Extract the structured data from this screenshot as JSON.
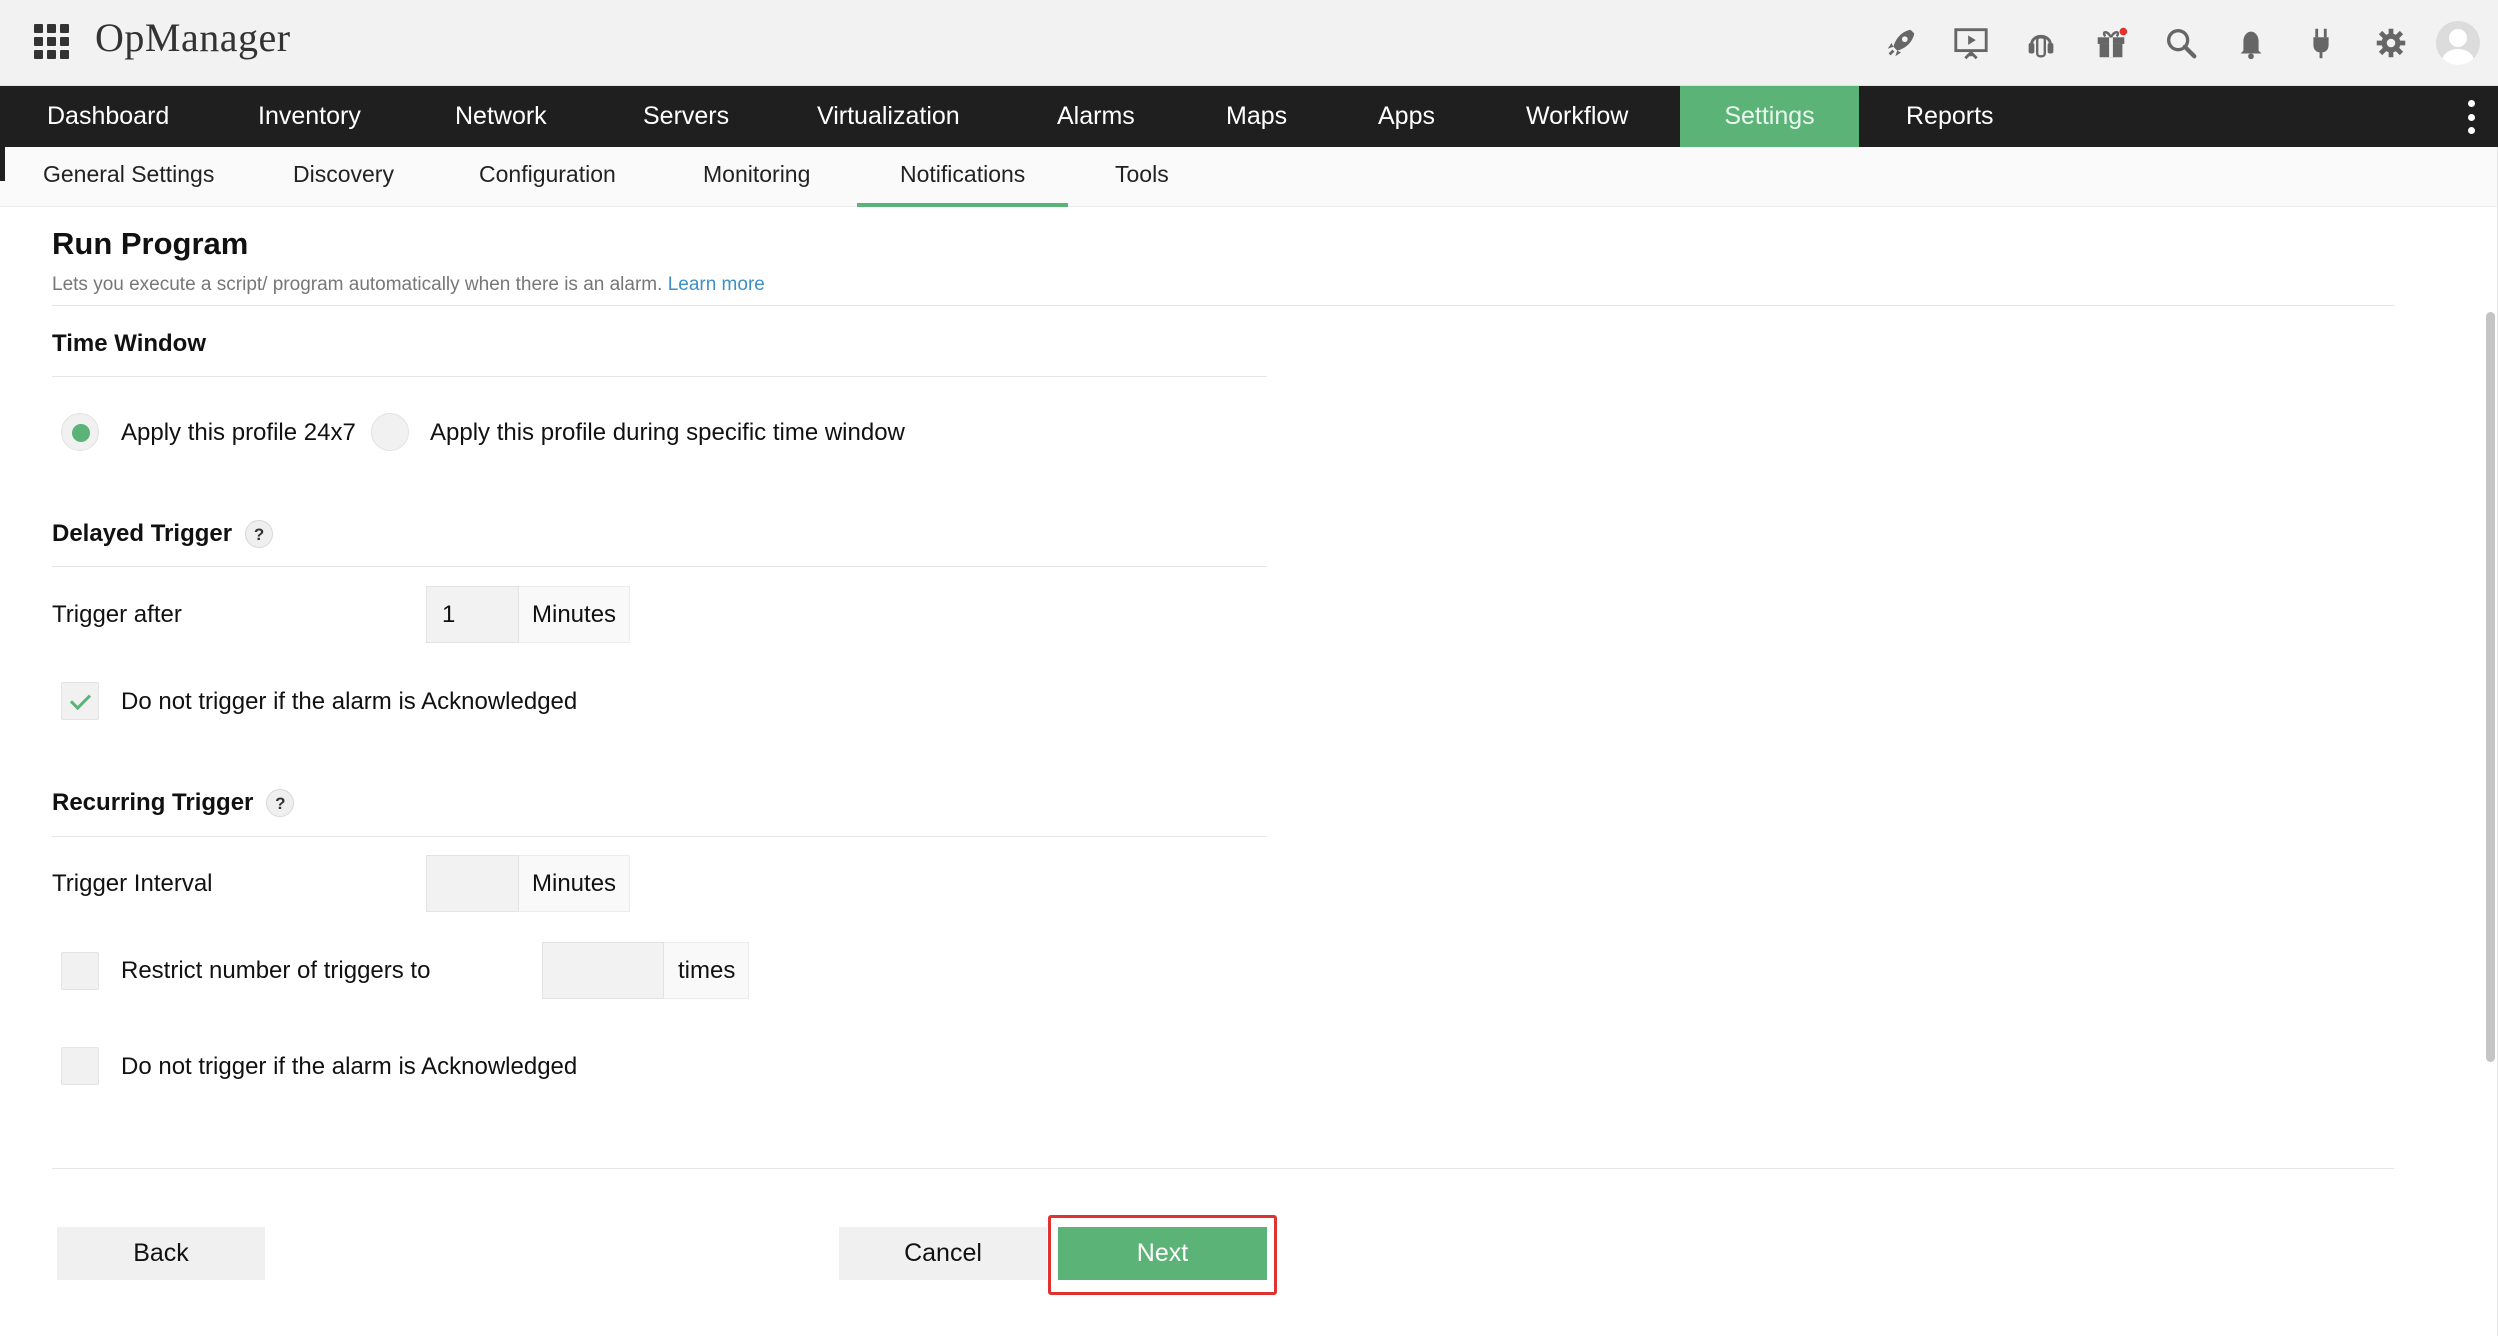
{
  "app": {
    "title": "OpManager"
  },
  "header": {
    "icons": [
      "rocket-icon",
      "presentation-icon",
      "support-icon",
      "gift-icon",
      "search-icon",
      "bell-icon",
      "plug-icon",
      "gear-icon",
      "avatar-icon"
    ]
  },
  "mainnav": {
    "items": [
      {
        "label": "Dashboard"
      },
      {
        "label": "Inventory"
      },
      {
        "label": "Network"
      },
      {
        "label": "Servers"
      },
      {
        "label": "Virtualization"
      },
      {
        "label": "Alarms"
      },
      {
        "label": "Maps"
      },
      {
        "label": "Apps"
      },
      {
        "label": "Workflow"
      },
      {
        "label": "Settings",
        "active": true
      },
      {
        "label": "Reports"
      }
    ]
  },
  "subnav": {
    "tabs": [
      {
        "label": "General Settings"
      },
      {
        "label": "Discovery"
      },
      {
        "label": "Configuration"
      },
      {
        "label": "Monitoring"
      },
      {
        "label": "Notifications",
        "active": true
      },
      {
        "label": "Tools"
      }
    ]
  },
  "page": {
    "title": "Run Program",
    "description": "Lets you execute a script/ program automatically when there is an alarm.",
    "learn_more": "Learn more"
  },
  "time_window": {
    "title": "Time Window",
    "option_24x7": "Apply this profile 24x7",
    "option_specific": "Apply this profile during specific time window",
    "selected": "24x7"
  },
  "delayed_trigger": {
    "title": "Delayed Trigger",
    "help": "?",
    "trigger_after_label": "Trigger after",
    "trigger_after_value": "1",
    "unit": "Minutes",
    "no_trigger_ack_label": "Do not trigger if the alarm is Acknowledged",
    "no_trigger_ack_checked": true
  },
  "recurring_trigger": {
    "title": "Recurring Trigger",
    "help": "?",
    "interval_label": "Trigger Interval",
    "interval_value": "",
    "unit": "Minutes",
    "restrict_label": "Restrict number of triggers to",
    "restrict_checked": false,
    "restrict_value": "",
    "restrict_unit": "times",
    "no_trigger_ack_label": "Do not trigger if the alarm is Acknowledged",
    "no_trigger_ack_checked": false
  },
  "actions": {
    "back": "Back",
    "cancel": "Cancel",
    "next": "Next"
  },
  "colors": {
    "accent": "#5cb377",
    "nav_bg": "#1f1f1f",
    "link": "#3d8fc8",
    "highlight": "#e0332f"
  }
}
